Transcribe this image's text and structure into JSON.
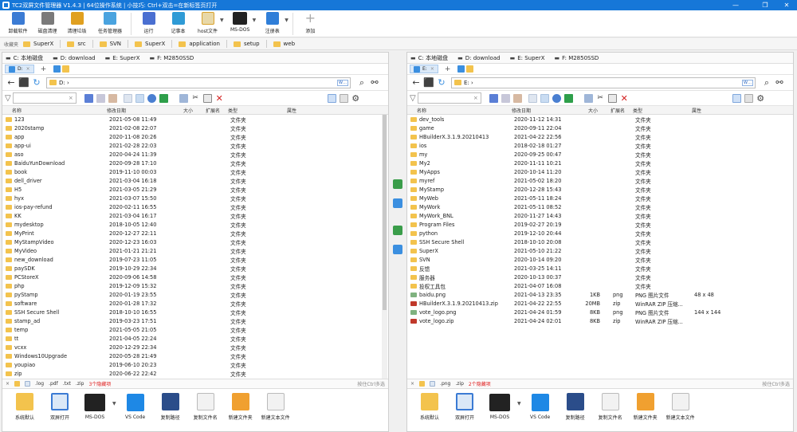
{
  "window": {
    "title": "TC2双屏文件管理器 V1.4.3 | 64位操作系统 | 小技巧: Ctrl+双击=在新标签页打开",
    "controls": [
      "—",
      "❐",
      "✕"
    ]
  },
  "ribbon": {
    "items": [
      {
        "label": "卸载软件",
        "icon": "uninstall-icon",
        "color": "#3b7bd4"
      },
      {
        "label": "磁盘清理",
        "icon": "disk-cleanup-icon",
        "color": "#6b6b6b"
      },
      {
        "label": "清理垃圾",
        "icon": "broom-icon",
        "color": "#e0a020"
      },
      {
        "label": "任务管理器",
        "icon": "task-manager-icon",
        "color": "#4aa3df"
      },
      {
        "label": "运行",
        "icon": "run-icon",
        "color": "#4a6fd1"
      },
      {
        "label": "记事本",
        "icon": "notepad-icon",
        "color": "#2f9bd6"
      },
      {
        "label": "host文件",
        "icon": "host-file-icon",
        "color": "#d9a22e"
      },
      {
        "label": "MS-DOS",
        "icon": "terminal-icon",
        "color": "#222222"
      },
      {
        "label": "注册表",
        "icon": "registry-icon",
        "color": "#2f7ed8"
      },
      {
        "label": "添加",
        "icon": "plus-icon",
        "color": "#aaaaaa"
      }
    ]
  },
  "favorites": {
    "label": "收藏夹",
    "items": [
      "SuperX",
      "src",
      "SVN",
      "SuperX",
      "application",
      "setup",
      "web"
    ]
  },
  "left": {
    "drives": [
      "C: 本地磁盘",
      "D: download",
      "E: SuperX",
      "F: M2850SSD"
    ],
    "tab_label": "D:",
    "address": "D: ›",
    "address_badge": "W…",
    "headers": {
      "name": "名称",
      "date": "修改日期",
      "size": "大小",
      "ext": "扩展名",
      "type": "类型",
      "prop": "属性"
    },
    "rows": [
      {
        "name": "123",
        "date": "2021-05-08 11:49",
        "size": "",
        "ext": "",
        "type": "文件夹",
        "prop": "",
        "kind": "folder"
      },
      {
        "name": "2020stamp",
        "date": "2021-02-08 22:07",
        "size": "",
        "ext": "",
        "type": "文件夹",
        "prop": "",
        "kind": "folder"
      },
      {
        "name": "app",
        "date": "2020-11-08 20:26",
        "size": "",
        "ext": "",
        "type": "文件夹",
        "prop": "",
        "kind": "folder"
      },
      {
        "name": "app-ui",
        "date": "2021-02-28 22:03",
        "size": "",
        "ext": "",
        "type": "文件夹",
        "prop": "",
        "kind": "folder"
      },
      {
        "name": "aso",
        "date": "2020-04-24 11:39",
        "size": "",
        "ext": "",
        "type": "文件夹",
        "prop": "",
        "kind": "folder"
      },
      {
        "name": "BaiduYunDownload",
        "date": "2020-09-28 17:10",
        "size": "",
        "ext": "",
        "type": "文件夹",
        "prop": "",
        "kind": "folder"
      },
      {
        "name": "book",
        "date": "2019-11-10 00:03",
        "size": "",
        "ext": "",
        "type": "文件夹",
        "prop": "",
        "kind": "folder"
      },
      {
        "name": "dell_driver",
        "date": "2021-03-04 16:18",
        "size": "",
        "ext": "",
        "type": "文件夹",
        "prop": "",
        "kind": "folder"
      },
      {
        "name": "H5",
        "date": "2021-03-05 21:29",
        "size": "",
        "ext": "",
        "type": "文件夹",
        "prop": "",
        "kind": "folder"
      },
      {
        "name": "hyx",
        "date": "2021-03-07 15:50",
        "size": "",
        "ext": "",
        "type": "文件夹",
        "prop": "",
        "kind": "folder"
      },
      {
        "name": "ios-pay-refund",
        "date": "2020-02-11 16:55",
        "size": "",
        "ext": "",
        "type": "文件夹",
        "prop": "",
        "kind": "folder"
      },
      {
        "name": "KK",
        "date": "2021-03-04 16:17",
        "size": "",
        "ext": "",
        "type": "文件夹",
        "prop": "",
        "kind": "folder"
      },
      {
        "name": "mydesktop",
        "date": "2018-10-05 12:40",
        "size": "",
        "ext": "",
        "type": "文件夹",
        "prop": "",
        "kind": "folder"
      },
      {
        "name": "MyPrint",
        "date": "2020-12-27 22:11",
        "size": "",
        "ext": "",
        "type": "文件夹",
        "prop": "",
        "kind": "folder"
      },
      {
        "name": "MyStampVideo",
        "date": "2020-12-23 16:03",
        "size": "",
        "ext": "",
        "type": "文件夹",
        "prop": "",
        "kind": "folder"
      },
      {
        "name": "MyVideo",
        "date": "2021-01-21 21:21",
        "size": "",
        "ext": "",
        "type": "文件夹",
        "prop": "",
        "kind": "folder"
      },
      {
        "name": "new_download",
        "date": "2019-07-23 11:05",
        "size": "",
        "ext": "",
        "type": "文件夹",
        "prop": "",
        "kind": "folder"
      },
      {
        "name": "paySDK",
        "date": "2019-10-29 22:34",
        "size": "",
        "ext": "",
        "type": "文件夹",
        "prop": "",
        "kind": "folder"
      },
      {
        "name": "PCStoreX",
        "date": "2020-09-06 14:58",
        "size": "",
        "ext": "",
        "type": "文件夹",
        "prop": "",
        "kind": "folder"
      },
      {
        "name": "php",
        "date": "2019-12-09 15:32",
        "size": "",
        "ext": "",
        "type": "文件夹",
        "prop": "",
        "kind": "folder"
      },
      {
        "name": "pyStamp",
        "date": "2020-01-19 23:55",
        "size": "",
        "ext": "",
        "type": "文件夹",
        "prop": "",
        "kind": "folder"
      },
      {
        "name": "software",
        "date": "2020-01-28 17:32",
        "size": "",
        "ext": "",
        "type": "文件夹",
        "prop": "",
        "kind": "folder"
      },
      {
        "name": "SSH Secure Shell",
        "date": "2018-10-10 16:55",
        "size": "",
        "ext": "",
        "type": "文件夹",
        "prop": "",
        "kind": "folder"
      },
      {
        "name": "stamp_ad",
        "date": "2019-03-23 17:51",
        "size": "",
        "ext": "",
        "type": "文件夹",
        "prop": "",
        "kind": "folder"
      },
      {
        "name": "temp",
        "date": "2021-05-05 21:05",
        "size": "",
        "ext": "",
        "type": "文件夹",
        "prop": "",
        "kind": "folder"
      },
      {
        "name": "tt",
        "date": "2021-04-05 22:24",
        "size": "",
        "ext": "",
        "type": "文件夹",
        "prop": "",
        "kind": "folder"
      },
      {
        "name": "vcxx",
        "date": "2020-12-29 22:34",
        "size": "",
        "ext": "",
        "type": "文件夹",
        "prop": "",
        "kind": "folder"
      },
      {
        "name": "Windows10Upgrade",
        "date": "2020-05-28 21:49",
        "size": "",
        "ext": "",
        "type": "文件夹",
        "prop": "",
        "kind": "folder"
      },
      {
        "name": "youpiao",
        "date": "2019-06-10 20:23",
        "size": "",
        "ext": "",
        "type": "文件夹",
        "prop": "",
        "kind": "folder"
      },
      {
        "name": "zip",
        "date": "2020-06-22 22:42",
        "size": "",
        "ext": "",
        "type": "文件夹",
        "prop": "",
        "kind": "folder"
      }
    ],
    "status": {
      "chips": [
        ".log",
        ".pdf",
        ".txt",
        ".zip"
      ],
      "count": "3个隐藏项",
      "hint": "按住Ctrl多选"
    }
  },
  "right": {
    "drives": [
      "C: 本地磁盘",
      "D: download",
      "E: SuperX",
      "F: M2850SSD"
    ],
    "tab_label": "E:",
    "address": "E: ›",
    "address_badge": "W…",
    "headers": {
      "name": "名称",
      "date": "修改日期",
      "size": "大小",
      "ext": "扩展名",
      "type": "类型",
      "prop": "属性"
    },
    "rows": [
      {
        "name": "dev_tools",
        "date": "2020-11-12 14:31",
        "size": "",
        "ext": "",
        "type": "文件夹",
        "prop": "",
        "kind": "folder"
      },
      {
        "name": "game",
        "date": "2020-09-11 22:04",
        "size": "",
        "ext": "",
        "type": "文件夹",
        "prop": "",
        "kind": "folder"
      },
      {
        "name": "HBuilderX.3.1.9.20210413",
        "date": "2021-04-22 22:56",
        "size": "",
        "ext": "",
        "type": "文件夹",
        "prop": "",
        "kind": "folder"
      },
      {
        "name": "ios",
        "date": "2018-02-18 01:27",
        "size": "",
        "ext": "",
        "type": "文件夹",
        "prop": "",
        "kind": "folder"
      },
      {
        "name": "my",
        "date": "2020-09-25 00:47",
        "size": "",
        "ext": "",
        "type": "文件夹",
        "prop": "",
        "kind": "folder"
      },
      {
        "name": "My2",
        "date": "2020-11-11 10:21",
        "size": "",
        "ext": "",
        "type": "文件夹",
        "prop": "",
        "kind": "folder"
      },
      {
        "name": "MyApps",
        "date": "2020-10-14 11:20",
        "size": "",
        "ext": "",
        "type": "文件夹",
        "prop": "",
        "kind": "folder"
      },
      {
        "name": "myref",
        "date": "2021-05-02 18:20",
        "size": "",
        "ext": "",
        "type": "文件夹",
        "prop": "",
        "kind": "folder"
      },
      {
        "name": "MyStamp",
        "date": "2020-12-28 15:43",
        "size": "",
        "ext": "",
        "type": "文件夹",
        "prop": "",
        "kind": "folder"
      },
      {
        "name": "MyWeb",
        "date": "2021-05-11 18:24",
        "size": "",
        "ext": "",
        "type": "文件夹",
        "prop": "",
        "kind": "folder"
      },
      {
        "name": "MyWork",
        "date": "2021-05-11 08:52",
        "size": "",
        "ext": "",
        "type": "文件夹",
        "prop": "",
        "kind": "folder"
      },
      {
        "name": "MyWork_BNL",
        "date": "2020-11-27 14:43",
        "size": "",
        "ext": "",
        "type": "文件夹",
        "prop": "",
        "kind": "folder"
      },
      {
        "name": "Program Files",
        "date": "2019-02-27 20:19",
        "size": "",
        "ext": "",
        "type": "文件夹",
        "prop": "",
        "kind": "folder"
      },
      {
        "name": "python",
        "date": "2019-12-10 20:44",
        "size": "",
        "ext": "",
        "type": "文件夹",
        "prop": "",
        "kind": "folder"
      },
      {
        "name": "SSH Secure Shell",
        "date": "2018-10-10 20:08",
        "size": "",
        "ext": "",
        "type": "文件夹",
        "prop": "",
        "kind": "folder"
      },
      {
        "name": "SuperX",
        "date": "2021-05-10 21:22",
        "size": "",
        "ext": "",
        "type": "文件夹",
        "prop": "",
        "kind": "folder"
      },
      {
        "name": "SVN",
        "date": "2020-10-14 09:20",
        "size": "",
        "ext": "",
        "type": "文件夹",
        "prop": "",
        "kind": "folder"
      },
      {
        "name": "反馈",
        "date": "2021-03-25 14:11",
        "size": "",
        "ext": "",
        "type": "文件夹",
        "prop": "",
        "kind": "folder"
      },
      {
        "name": "服务器",
        "date": "2020-10-13 00:37",
        "size": "",
        "ext": "",
        "type": "文件夹",
        "prop": "",
        "kind": "folder"
      },
      {
        "name": "投权工具包",
        "date": "2021-04-07 16:08",
        "size": "",
        "ext": "",
        "type": "文件夹",
        "prop": "",
        "kind": "folder"
      },
      {
        "name": "baidu.png",
        "date": "2021-04-13 23:35",
        "size": "1KB",
        "ext": "png",
        "type": "PNG 图片文件",
        "prop": "48 x 48",
        "kind": "img"
      },
      {
        "name": "HBuilderX.3.1.9.20210413.zip",
        "date": "2021-04-22 22:55",
        "size": "20MB",
        "ext": "zip",
        "type": "WinRAR ZIP 压缩...",
        "prop": "",
        "kind": "zip"
      },
      {
        "name": "vote_logo.png",
        "date": "2021-04-24 01:59",
        "size": "8KB",
        "ext": "png",
        "type": "PNG 图片文件",
        "prop": "144 x 144",
        "kind": "img"
      },
      {
        "name": "vote_logo.zip",
        "date": "2021-04-24 02:01",
        "size": "8KB",
        "ext": "zip",
        "type": "WinRAR ZIP 压缩...",
        "prop": "",
        "kind": "zip"
      }
    ],
    "status": {
      "chips": [
        ".png",
        ".zip"
      ],
      "count": "2个隐藏项",
      "hint": "按住Ctrl多选"
    }
  },
  "bottombar": {
    "items": [
      {
        "label": "系统默认",
        "icon": "folder-icon",
        "color": "#f3c34d"
      },
      {
        "label": "双屏打开",
        "icon": "dual-screen-icon",
        "color": "#3b7bd4"
      },
      {
        "label": "MS-DOS",
        "icon": "terminal-icon",
        "color": "#222222"
      },
      {
        "label": "VS Code",
        "icon": "vscode-icon",
        "color": "#1e88e5"
      },
      {
        "label": "复制路径",
        "icon": "copy-path-icon",
        "color": "#2b4d8a"
      },
      {
        "label": "复制文件名",
        "icon": "copy-filename-icon",
        "color": "#dddddd"
      },
      {
        "label": "新建文件夹",
        "icon": "new-folder-icon",
        "color": "#f0a030"
      },
      {
        "label": "新建文本文件",
        "icon": "new-text-file-icon",
        "color": "#dddddd"
      }
    ]
  },
  "colors": {
    "accent": "#1677d8",
    "folder": "#f3c34d",
    "warning_count": "#e02020"
  }
}
